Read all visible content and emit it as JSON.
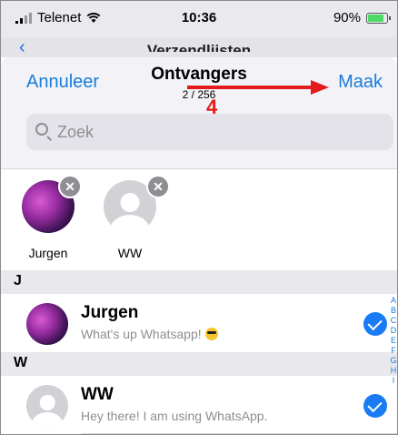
{
  "status": {
    "carrier": "Telenet",
    "time": "10:36",
    "battery": "90%"
  },
  "background_page": {
    "title": "Verzendlijsten"
  },
  "nav": {
    "cancel": "Annuleer",
    "title": "Ontvangers",
    "count": "2 / 256",
    "create": "Maak"
  },
  "search": {
    "placeholder": "Zoek"
  },
  "selected": [
    {
      "name": "Jurgen"
    },
    {
      "name": "WW"
    }
  ],
  "sections": [
    {
      "letter": "J",
      "contacts": [
        {
          "name": "Jurgen",
          "status": "What's up Whatsapp!",
          "selected": true
        }
      ]
    },
    {
      "letter": "W",
      "contacts": [
        {
          "name": "WW",
          "status": "Hey there! I am using WhatsApp.",
          "selected": true
        }
      ]
    }
  ],
  "index_letters": [
    "A",
    "B",
    "C",
    "D",
    "E",
    "F",
    "G",
    "H",
    "I"
  ],
  "annotation": {
    "step": "4",
    "color": "#e31b1b"
  },
  "colors": {
    "accent": "#1a7cd9",
    "check": "#1a7cf5"
  }
}
